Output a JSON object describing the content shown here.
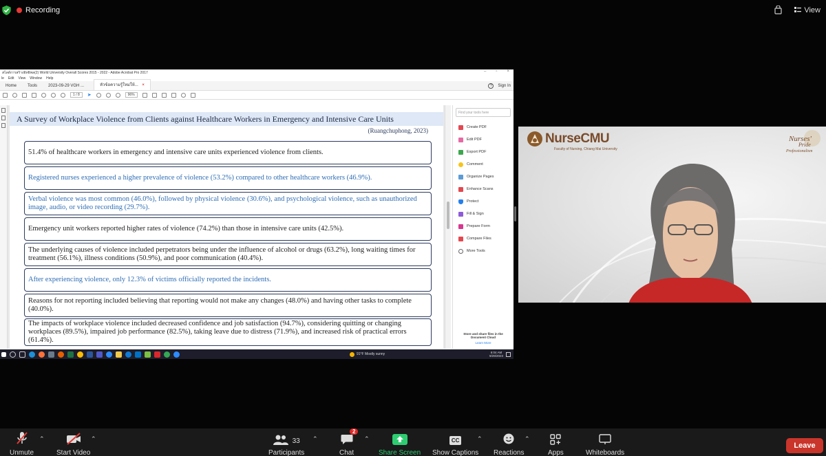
{
  "zoom": {
    "recording_label": "Recording",
    "view_label": "View",
    "controls": {
      "unmute": "Unmute",
      "start_video": "Start Video",
      "participants": "Participants",
      "participants_count": "33",
      "chat": "Chat",
      "chat_badge": "2",
      "share_screen": "Share Screen",
      "show_captions": "Show Captions",
      "reactions": "Reactions",
      "apps": "Apps",
      "whiteboards": "Whiteboards",
      "leave": "Leave",
      "cc_glyph": "CC"
    }
  },
  "acrobat": {
    "window_title": "สไลด์การสร้างอิทธิพล(2) World University Overall Scores 2015 - 2022 - Adobe Acrobat Pro 2017",
    "menu": [
      "le",
      "Edit",
      "View",
      "Window",
      "Help"
    ],
    "tabs": {
      "home": "Home",
      "tools": "Tools",
      "tab1": "2023-09-29 VGH ...",
      "tab2": "หัวข้อความรู้ใหม่ให้..."
    },
    "sign_in": "Sign In",
    "page_indicator": "1 / 8",
    "zoom_level": "96%",
    "find_tools_placeholder": "Find your tools here",
    "tools": [
      "Create PDF",
      "Edit PDF",
      "Export PDF",
      "Comment",
      "Organize Pages",
      "Enhance Scans",
      "Protect",
      "Fill & Sign",
      "Prepare Form",
      "Compare Files",
      "More Tools"
    ],
    "cloud_note": "Store and share files in the Document Cloud",
    "learn_more": "Learn More"
  },
  "slide": {
    "title": "A Survey of Workplace Violence from Clients against Healthcare Workers in Emergency and Intensive Care Units",
    "citation": "(Ruangchuphong, 2023)",
    "findings": [
      "51.4% of healthcare workers in emergency and intensive care units experienced violence from clients.",
      "Registered nurses experienced a higher prevalence of violence (53.2%) compared to other healthcare workers (46.9%).",
      "Verbal violence was most common (46.0%), followed by physical violence  (30.6%), and psychological violence, such as unauthorized image,  audio, or video recording (29.7%).",
      "Emergency unit workers reported higher rates of violence (74.2%) than those in intensive care units (42.5%).",
      "The underlying causes of violence included perpetrators being under the influence of alcohol or drugs (63.2%), long waiting times for treatment (56.1%), illness conditions (50.9%), and poor communication  (40.4%).",
      "After experiencing violence, only 12.3% of victims officially reported the incidents.",
      "Reasons for not reporting included believing that reporting would not make any changes (48.0%) and having other tasks to complete (40.0%).",
      "The impacts of workplace violence included decreased confidence and job satisfaction  (94.7%), considering quitting or changing workplaces (89.5%), impaired job performance (82.5%), taking leave due to distress (71.9%), and increased risk of practical errors (61.4%)."
    ]
  },
  "taskbar": {
    "weather": "91°F  Mostly sunny",
    "time": "6:04 AM",
    "date": "9/29/2023"
  },
  "video": {
    "logo_text": "NurseCMU",
    "logo_sub": "Faculty of Nursing, Chiang Mai University",
    "pride_text": "Nurses' Pride Professionalism"
  }
}
